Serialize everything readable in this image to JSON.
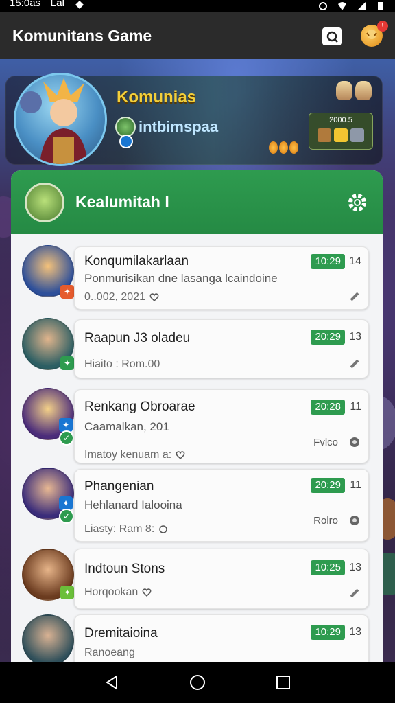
{
  "status_bar": {
    "time": "15:0as",
    "left_extra": "Lal"
  },
  "app_bar": {
    "title": "Komunitans Game",
    "notification_count": "!"
  },
  "hero": {
    "title": "Komunias",
    "username": "intbimspaa",
    "inventory_value": "2000.5"
  },
  "panel": {
    "title": "Kealumitah I"
  },
  "conversations": [
    {
      "name": "Konqumilakarlaan",
      "line1": "Ponmurisikan dne lasanga lcaindoine",
      "line2": "0..002, 2021",
      "time": "10:29",
      "count": "14",
      "status": ""
    },
    {
      "name": "Raapun J3 oladeu",
      "line1": "",
      "line2": "Hiaito : Rom.00",
      "time": "20:29",
      "count": "13",
      "status": ""
    },
    {
      "name": "Renkang Obroarae",
      "line1": "Caamalkan, 201",
      "line2": "Imatoy kenuam a:",
      "time": "20:28",
      "count": "11",
      "status": "Fvlco"
    },
    {
      "name": "Phangenian",
      "line1": "Hehlanard Ialooina",
      "line2": "Liasty: Ram 8:",
      "time": "20:29",
      "count": "11",
      "status": "Rolro"
    },
    {
      "name": "Indtoun Stons",
      "line1": "",
      "line2": "Horqookan",
      "time": "10:25",
      "count": "13",
      "status": ""
    },
    {
      "name": "Dremitaioina",
      "line1": "",
      "line2": "Ranoeang",
      "time": "10:29",
      "count": "13",
      "status": ""
    }
  ],
  "colors": {
    "accent_green": "#2e9b4f",
    "appbar": "#2b2b2b",
    "hero_title": "#f3cf3a"
  },
  "icons": {
    "appbar": [
      "chat-icon",
      "profile-avatar-icon"
    ],
    "panel": [
      "settings-gear-icon"
    ],
    "nav": [
      "back-icon",
      "home-icon",
      "recents-icon"
    ]
  }
}
